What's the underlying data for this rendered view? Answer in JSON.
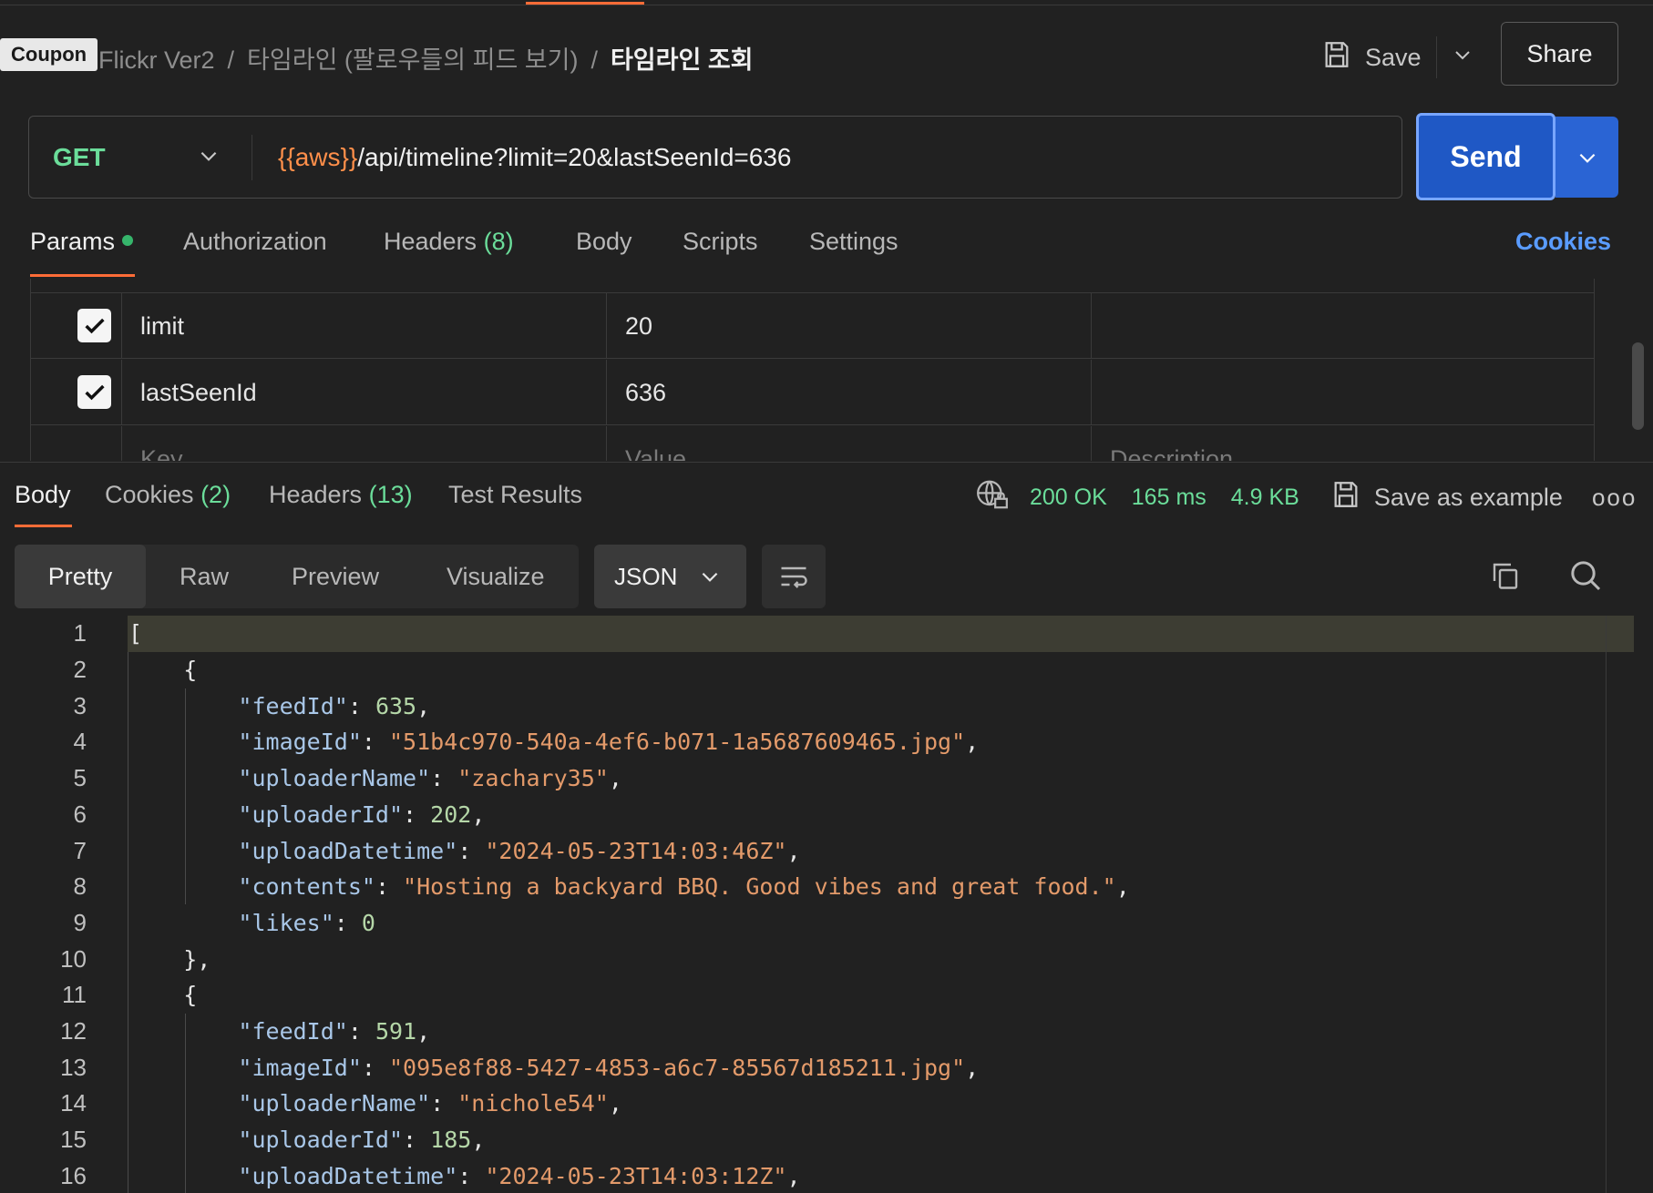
{
  "header": {
    "coupon_label": "Coupon",
    "breadcrumb": [
      "Flickr Ver2",
      "타임라인 (팔로우들의 피드 보기)",
      "타임라인 조회"
    ],
    "separator": "/",
    "save_label": "Save",
    "share_label": "Share"
  },
  "request": {
    "method": "GET",
    "url_variable": "{{aws}}",
    "url_path": "/api/timeline?limit=20&lastSeenId=636",
    "send_label": "Send"
  },
  "request_tabs": {
    "params": "Params",
    "authorization": "Authorization",
    "headers": "Headers",
    "headers_count": "(8)",
    "body": "Body",
    "scripts": "Scripts",
    "settings": "Settings",
    "cookies": "Cookies"
  },
  "params": {
    "rows": [
      {
        "key": "limit",
        "value": "20",
        "description": "",
        "checked": true
      },
      {
        "key": "lastSeenId",
        "value": "636",
        "description": "",
        "checked": true
      }
    ],
    "placeholder_key": "Key",
    "placeholder_value": "Value",
    "placeholder_description": "Description"
  },
  "response_tabs": {
    "body": "Body",
    "cookies": "Cookies",
    "cookies_count": "(2)",
    "headers": "Headers",
    "headers_count": "(13)",
    "test_results": "Test Results"
  },
  "response_meta": {
    "status": "200 OK",
    "time": "165 ms",
    "size": "4.9 KB",
    "save_example": "Save as example",
    "more": "ooo"
  },
  "view": {
    "tabs": [
      "Pretty",
      "Raw",
      "Preview",
      "Visualize"
    ],
    "format": "JSON"
  },
  "code": {
    "line_numbers": [
      "1",
      "2",
      "3",
      "4",
      "5",
      "6",
      "7",
      "8",
      "9",
      "10",
      "11",
      "12",
      "13",
      "14",
      "15",
      "16"
    ],
    "feeds": [
      {
        "feedId": "635",
        "imageId": "\"51b4c970-540a-4ef6-b071-1a5687609465.jpg\"",
        "uploaderName": "\"zachary35\"",
        "uploaderId": "202",
        "uploadDatetime": "\"2024-05-23T14:03:46Z\"",
        "contents": "\"Hosting a backyard BBQ. Good vibes and great food.\"",
        "likes": "0"
      },
      {
        "feedId": "591",
        "imageId": "\"095e8f88-5427-4853-a6c7-85567d185211.jpg\"",
        "uploaderName": "\"nichole54\"",
        "uploaderId": "185",
        "uploadDatetime": "\"2024-05-23T14:03:12Z\""
      }
    ],
    "keys": {
      "feedId": "\"feedId\"",
      "imageId": "\"imageId\"",
      "uploaderName": "\"uploaderName\"",
      "uploaderId": "\"uploaderId\"",
      "uploadDatetime": "\"uploadDatetime\"",
      "contents": "\"contents\"",
      "likes": "\"likes\""
    }
  },
  "colors": {
    "accent": "#ff6c37",
    "send": "#1f58c5",
    "status_green": "#6bdd9a",
    "link_blue": "#5a9cff"
  },
  "icons": [
    "save-icon",
    "chevron-down-icon",
    "check-icon",
    "globe-lock-icon",
    "wrap-icon",
    "copy-icon",
    "search-icon",
    "more-icon"
  ]
}
